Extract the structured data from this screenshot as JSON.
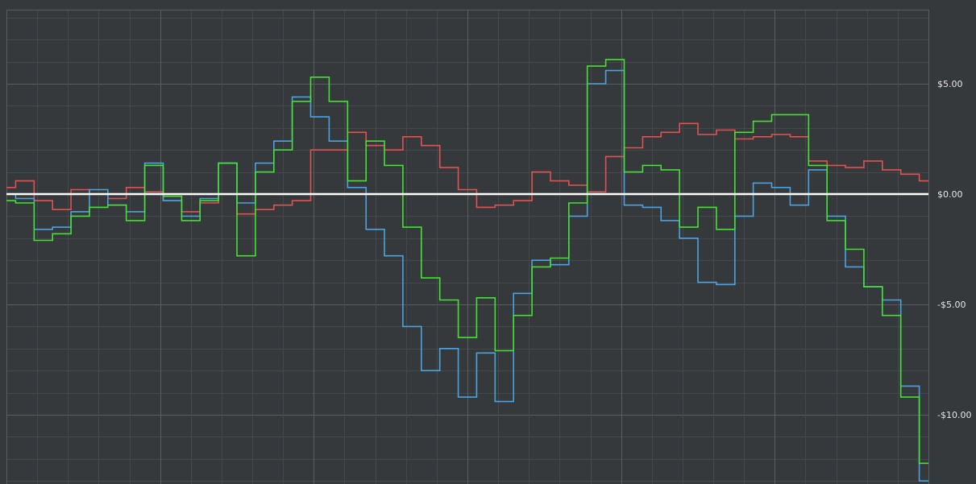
{
  "chart_data": {
    "type": "line",
    "title": "",
    "xlabel": "",
    "ylabel": "",
    "ylim": [
      -13.0,
      8.4
    ],
    "y_ticks": [
      {
        "value": 5,
        "label": "$5.00"
      },
      {
        "value": 0,
        "label": "$0.00"
      },
      {
        "value": -5,
        "label": "-$5.00"
      },
      {
        "value": -10,
        "label": "-$10.00"
      }
    ],
    "grid": true,
    "legend": "none",
    "zero_line": true,
    "x": [
      0,
      2,
      4,
      6,
      8,
      10,
      12,
      14,
      16,
      18,
      20,
      22,
      24,
      26,
      28,
      30,
      32,
      34,
      36,
      38,
      40,
      42,
      44,
      46,
      48,
      50,
      52,
      54,
      56,
      58,
      60,
      62,
      64,
      66,
      68,
      70,
      72,
      74,
      76,
      78,
      80,
      82,
      84,
      86,
      88,
      90,
      92,
      94,
      96,
      98,
      100
    ],
    "series": [
      {
        "color": "#e05252",
        "values": [
          0.3,
          0.6,
          -0.3,
          -0.7,
          0.2,
          0.0,
          -0.2,
          0.3,
          0.1,
          -0.3,
          -0.8,
          -0.4,
          0.0,
          -0.9,
          -0.7,
          -0.5,
          -0.3,
          2.0,
          2.0,
          2.8,
          2.2,
          2.0,
          2.6,
          2.2,
          1.2,
          0.2,
          -0.6,
          -0.5,
          -0.3,
          1.0,
          0.6,
          0.4,
          0.1,
          1.7,
          2.1,
          2.6,
          2.8,
          3.2,
          2.7,
          2.9,
          2.5,
          2.6,
          2.7,
          2.6,
          1.5,
          1.3,
          1.2,
          1.5,
          1.1,
          0.9,
          0.6
        ]
      },
      {
        "color": "#4aa3e0",
        "values": [
          0.0,
          -0.2,
          -1.6,
          -1.5,
          -0.8,
          0.2,
          -0.5,
          -0.8,
          1.4,
          -0.3,
          -1.0,
          -0.2,
          1.4,
          -0.4,
          1.4,
          2.4,
          4.4,
          3.5,
          2.4,
          0.3,
          -1.6,
          -2.8,
          -6.0,
          -8.0,
          -7.0,
          -9.2,
          -7.2,
          -9.4,
          -4.5,
          -3.0,
          -3.2,
          -1.0,
          5.0,
          5.6,
          -0.5,
          -0.6,
          -1.2,
          -2.0,
          -4.0,
          -4.1,
          -1.0,
          0.5,
          0.3,
          -0.5,
          1.1,
          -1.0,
          -3.3,
          -4.2,
          -4.8,
          -8.7,
          -13.0
        ]
      },
      {
        "color": "#44e034",
        "values": [
          -0.3,
          -0.4,
          -2.1,
          -1.8,
          -1.0,
          -0.6,
          -0.5,
          -1.2,
          1.3,
          -0.1,
          -1.2,
          -0.3,
          1.4,
          -2.8,
          1.0,
          2.0,
          4.2,
          5.3,
          4.2,
          0.6,
          2.4,
          1.3,
          -1.5,
          -3.8,
          -4.8,
          -6.5,
          -4.7,
          -7.1,
          -5.5,
          -3.3,
          -2.9,
          -0.4,
          5.8,
          6.1,
          1.0,
          1.3,
          1.1,
          -1.5,
          -0.6,
          -1.6,
          2.8,
          3.3,
          3.6,
          3.6,
          1.3,
          -1.2,
          -2.5,
          -4.2,
          -5.5,
          -9.2,
          -12.2
        ]
      }
    ]
  }
}
